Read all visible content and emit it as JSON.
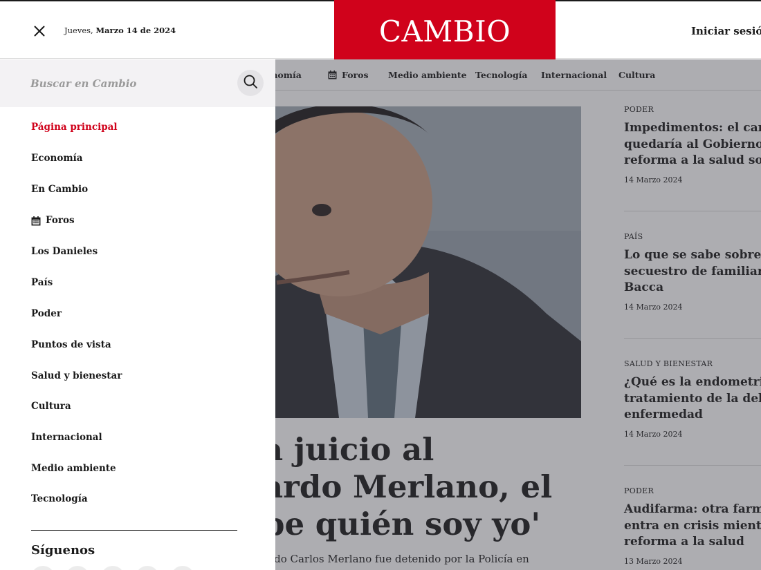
{
  "header": {
    "date_day": "Jueves,",
    "date_full": "Marzo 14 de 2024",
    "logo": "CAMBIO",
    "login": "Iniciar sesió",
    "icons": {
      "close": "close-icon"
    }
  },
  "colors": {
    "brand_red": "#d0021b",
    "overlay": "rgba(60,60,70,0.42)"
  },
  "nav": {
    "items": [
      {
        "label": "onomía"
      },
      {
        "label": "Foros",
        "icon": "calendar-icon"
      },
      {
        "label": "Medio ambiente"
      },
      {
        "label": "Tecnología"
      },
      {
        "label": "Internacional"
      },
      {
        "label": "Cultura"
      }
    ]
  },
  "hero": {
    "headline_lines": [
      "a juicio al",
      "ardo Merlano, el",
      "be quién soy yo'"
    ],
    "summary": "ardo Carlos Merlano fue detenido por la Policía en"
  },
  "sidebar_articles": [
    {
      "section": "PODER",
      "title_lines": [
        "Impedimentos: el camb",
        "quedaría al Gobierno p",
        "reforma a la salud sob"
      ],
      "date": "14 Marzo 2024"
    },
    {
      "section": "PAÍS",
      "title_lines": [
        "Lo que se sabe sobre el",
        "secuestro de familiare",
        "Bacca"
      ],
      "date": "14 Marzo 2024"
    },
    {
      "section": "SALUD Y BIENESTAR",
      "title_lines": [
        "¿Qué es la endometrio",
        "tratamiento de la debi",
        "enfermedad"
      ],
      "date": "14 Marzo 2024"
    },
    {
      "section": "PODER",
      "title_lines": [
        "Audifarma: otra farma",
        "entra en crisis mientra",
        "reforma a la salud"
      ],
      "date": "13 Marzo 2024"
    }
  ],
  "drawer": {
    "search": {
      "placeholder": "Buscar en Cambio",
      "value": "",
      "icon": "search-icon"
    },
    "menu": [
      {
        "label": "Página principal",
        "active": true
      },
      {
        "label": "Economía"
      },
      {
        "label": "En Cambio"
      },
      {
        "label": "Foros",
        "icon": "calendar-icon"
      },
      {
        "label": "Los Danieles"
      },
      {
        "label": "País"
      },
      {
        "label": "Poder"
      },
      {
        "label": "Puntos de vista"
      },
      {
        "label": "Salud y bienestar"
      },
      {
        "label": "Cultura"
      },
      {
        "label": "Internacional"
      },
      {
        "label": "Medio ambiente"
      },
      {
        "label": "Tecnología"
      }
    ],
    "follow_title": "Síguenos"
  }
}
